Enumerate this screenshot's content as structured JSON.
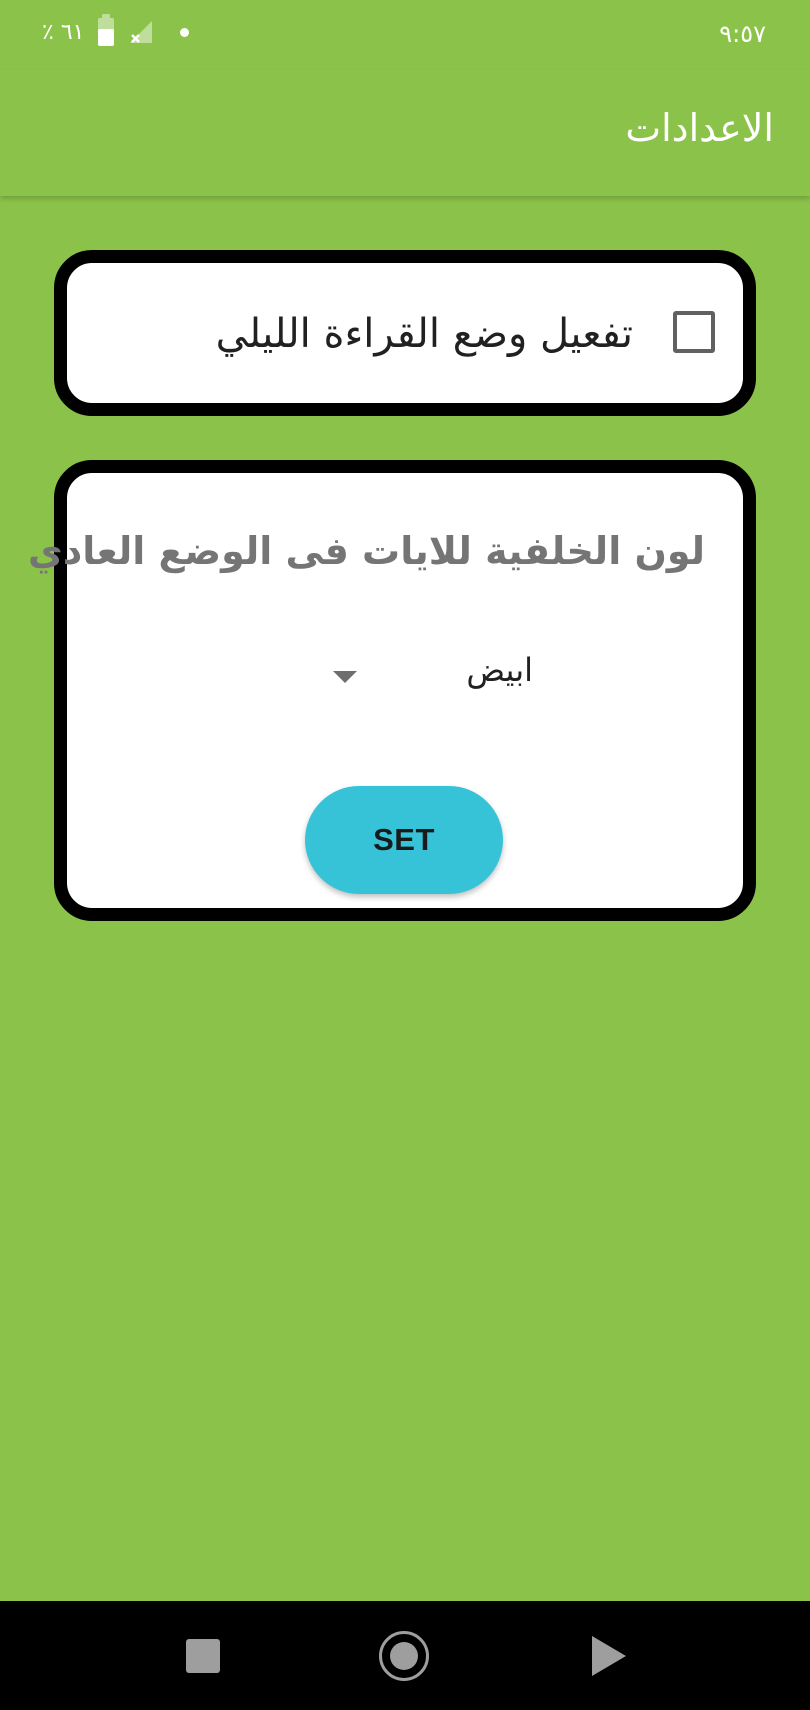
{
  "status_bar": {
    "time": "٩:٥٧",
    "battery_text": "٦١ ٪",
    "battery_level": 0.61,
    "icons": [
      "battery-icon",
      "signal-off-icon",
      "notification-dot-icon"
    ]
  },
  "app_bar": {
    "title": "الاعدادات"
  },
  "night_mode": {
    "label": "تفعيل وضع القراءة الليلي",
    "checked": false
  },
  "background": {
    "title": "لون الخلفية للايات فى الوضع العادي",
    "selected_value": "ابيض",
    "set_button_label": "SET"
  },
  "colors": {
    "background": "#8BC34A",
    "card": "#FFFFFF",
    "card_border": "#000000",
    "button": "#36C3D7",
    "nav_bar": "#000000"
  },
  "nav_bar": {
    "icons": [
      "recents-square-icon",
      "home-circle-icon",
      "back-triangle-icon"
    ]
  }
}
